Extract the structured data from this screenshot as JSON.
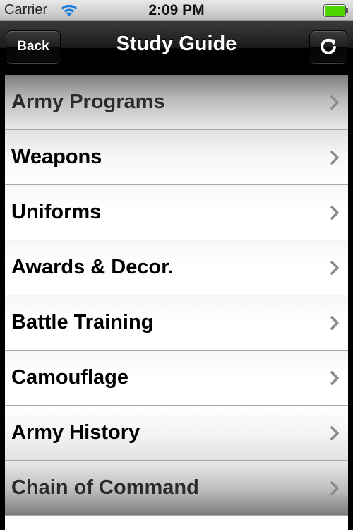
{
  "status_bar": {
    "carrier": "Carrier",
    "time": "2:09 PM",
    "wifi_icon": "wifi-icon",
    "battery_icon": "battery-icon",
    "battery_color": "#4cd400"
  },
  "nav_bar": {
    "title": "Study Guide",
    "back_label": "Back",
    "refresh_icon": "refresh-icon"
  },
  "list": {
    "items": [
      {
        "label": "Army Programs"
      },
      {
        "label": "Weapons"
      },
      {
        "label": "Uniforms"
      },
      {
        "label": "Awards & Decor."
      },
      {
        "label": "Battle Training"
      },
      {
        "label": "Camouflage"
      },
      {
        "label": "Army History"
      },
      {
        "label": "Chain of Command"
      }
    ],
    "chevron_icon": "chevron-right-icon"
  }
}
